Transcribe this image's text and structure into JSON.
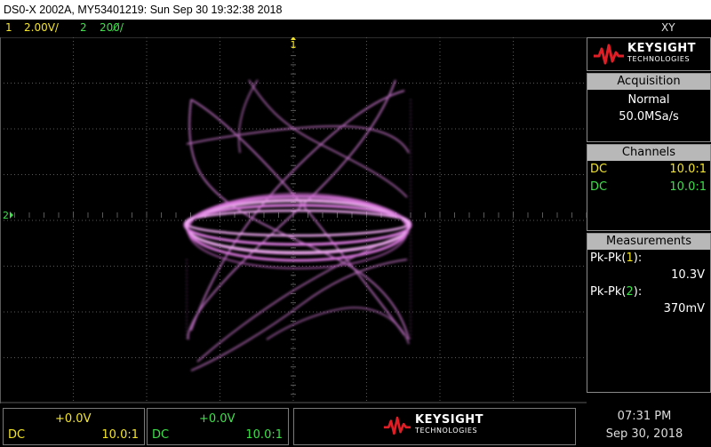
{
  "window": {
    "title": "DS0-X 2002A, MY53401219: Sun Sep 30 19:32:38 2018"
  },
  "status": {
    "ch1_num": "1",
    "ch1_scale": "2.00V/",
    "ch2_num": "2",
    "ch2_scale": "200̸/",
    "mode": "XY"
  },
  "screen": {
    "ch1_marker": "1",
    "ch2_marker": "2"
  },
  "brand": {
    "name": "KEYSIGHT",
    "sub": "TECHNOLOGIES"
  },
  "acquisition": {
    "title": "Acquisition",
    "mode": "Normal",
    "rate": "50.0MSa/s"
  },
  "channels": {
    "title": "Channels",
    "rows": [
      {
        "coupling": "DC",
        "probe": "10.0:1"
      },
      {
        "coupling": "DC",
        "probe": "10.0:1"
      }
    ]
  },
  "measurements": {
    "title": "Measurements",
    "items": [
      {
        "label_prefix": "Pk-Pk(",
        "channel": "1",
        "label_suffix": "):",
        "value": "10.3V"
      },
      {
        "label_prefix": "Pk-Pk(",
        "channel": "2",
        "label_suffix": "):",
        "value": "370mV"
      }
    ]
  },
  "footer": {
    "ch1": {
      "offset": "+0.0V",
      "coupling": "DC",
      "probe": "10.0:1"
    },
    "ch2": {
      "offset": "+0.0V",
      "coupling": "DC",
      "probe": "10.0:1"
    },
    "time": "07:31 PM",
    "date": "Sep 30, 2018"
  },
  "colors": {
    "ch1": "#f3e52b",
    "ch2": "#3ee04a",
    "trace": "#e27ee6",
    "grid": "#5a5a5a"
  }
}
